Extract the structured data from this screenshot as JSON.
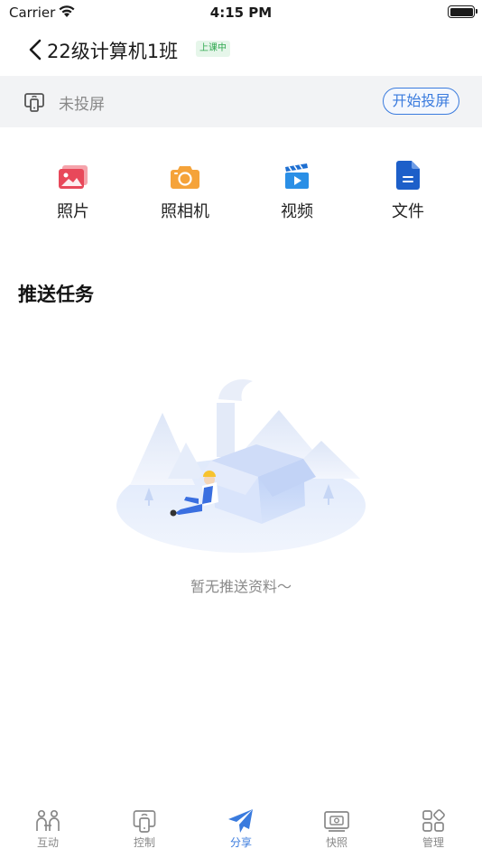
{
  "status_bar": {
    "carrier": "Carrier",
    "time": "4:15 PM"
  },
  "nav": {
    "title": "22级计算机1班",
    "class_status": "上课中"
  },
  "projection": {
    "status": "未投屏",
    "button": "开始投屏"
  },
  "actions": [
    {
      "label": "照片",
      "icon": "photo-icon"
    },
    {
      "label": "照相机",
      "icon": "camera-icon"
    },
    {
      "label": "视频",
      "icon": "video-icon"
    },
    {
      "label": "文件",
      "icon": "file-icon"
    }
  ],
  "section": {
    "title": "推送任务",
    "empty_text": "暂无推送资料～"
  },
  "tabs": [
    {
      "label": "互动",
      "icon": "interact-icon",
      "active": false
    },
    {
      "label": "控制",
      "icon": "control-icon",
      "active": false
    },
    {
      "label": "分享",
      "icon": "share-icon",
      "active": true
    },
    {
      "label": "快照",
      "icon": "snapshot-icon",
      "active": false
    },
    {
      "label": "管理",
      "icon": "manage-icon",
      "active": false
    }
  ],
  "colors": {
    "accent": "#3a7bde",
    "live_green": "#2fa84f",
    "photo": "#e8485a",
    "camera": "#f5a33a",
    "video": "#2a8fe6",
    "file": "#1d5fc9"
  }
}
